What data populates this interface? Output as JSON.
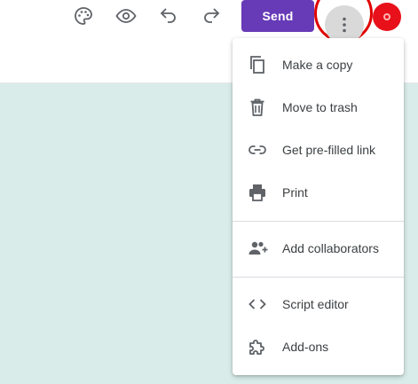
{
  "colors": {
    "accent": "#673ab7",
    "canvas": "#d9ece9",
    "highlight_ring": "#e00000",
    "avatar": "#e8101a"
  },
  "toolbar": {
    "icons": [
      "palette-icon",
      "eye-icon",
      "undo-icon",
      "redo-icon"
    ],
    "send_label": "Send",
    "more_icon": "vertical-dots-icon"
  },
  "menu": {
    "items": [
      {
        "label": "Make a copy",
        "icon": "copy-icon"
      },
      {
        "label": "Move to trash",
        "icon": "trash-icon"
      },
      {
        "label": "Get pre-filled link",
        "icon": "link-icon"
      },
      {
        "label": "Print",
        "icon": "printer-icon"
      },
      {
        "label": "Add collaborators",
        "icon": "add-people-icon"
      },
      {
        "label": "Script editor",
        "icon": "code-icon"
      },
      {
        "label": "Add-ons",
        "icon": "puzzle-icon"
      }
    ]
  }
}
